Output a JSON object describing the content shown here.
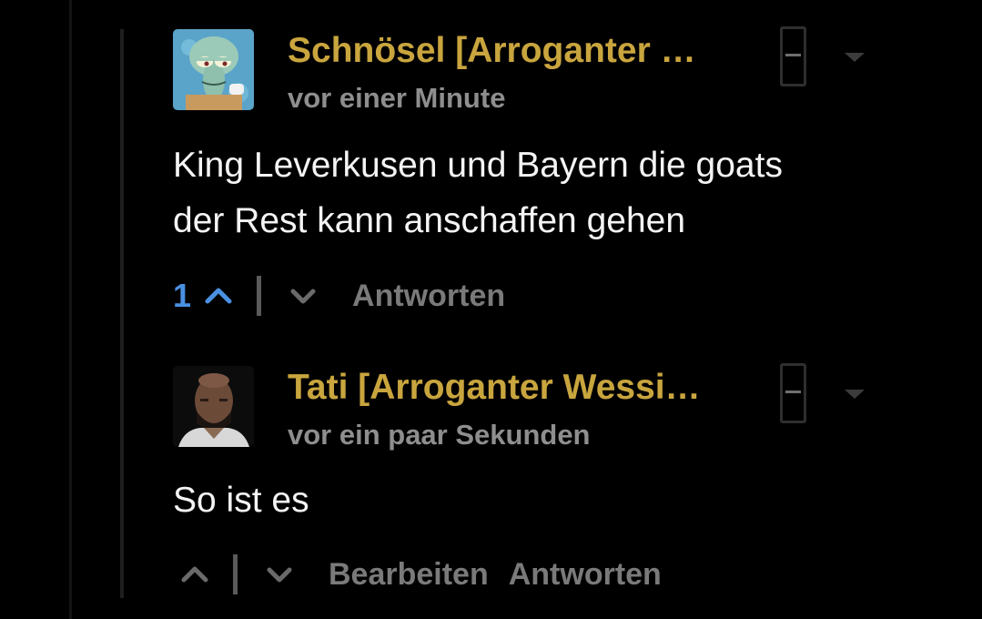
{
  "comments": [
    {
      "username": "Schnösel [Arroganter …",
      "timestamp": "vor einer Minute",
      "body_lines": [
        "King Leverkusen und Bayern die goats",
        "der Rest kann anschaffen gehen"
      ],
      "vote_count": "1",
      "upvote_active": true,
      "actions": [
        "Antworten"
      ],
      "avatar_icon": "cartoon-squid-avatar"
    },
    {
      "username": "Tati [Arroganter Wessi…",
      "timestamp": "vor ein paar Sekunden",
      "body_lines": [
        "So ist es"
      ],
      "vote_count": "",
      "upvote_active": false,
      "actions": [
        "Bearbeiten",
        "Antworten"
      ],
      "avatar_icon": "user-photo-avatar"
    }
  ],
  "colors": {
    "background": "#000000",
    "username": "#c9a53e",
    "timestamp": "#8e8e8e",
    "body": "#f4f4f4",
    "vote_active": "#4a90e2",
    "action": "#7a7a7a"
  }
}
